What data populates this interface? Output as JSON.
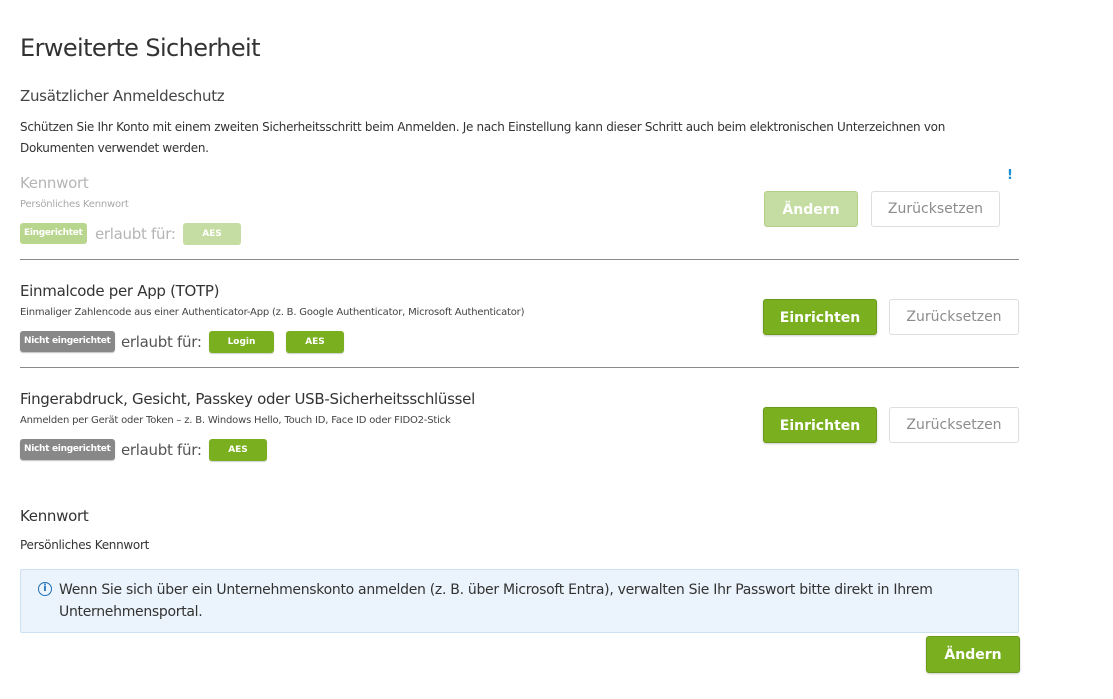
{
  "page": {
    "title": "Erweiterte Sicherheit"
  },
  "login_protection": {
    "title": "Zusätzlicher Anmeldeschutz",
    "description": "Schützen Sie Ihr Konto mit einem zweiten Sicherheitsschritt beim Anmelden. Je nach Einstellung kann dieser Schritt auch beim elektronischen Unterzeichnen von Dokumenten verwendet werden.",
    "allowed_label": "erlaubt für:",
    "methods": [
      {
        "name": "Kennwort",
        "subtitle": "Persönliches Kennwort",
        "status": "Eingerichtet",
        "tags": [
          "AES"
        ],
        "warning_icon": "!",
        "primary_action": "Ändern",
        "secondary_action": "Zurücksetzen",
        "disabled": true
      },
      {
        "name": "Einmalcode per App (TOTP)",
        "subtitle": "Einmaliger Zahlencode aus einer Authenticator-App (z. B. Google Authenticator, Microsoft Authenticator)",
        "status": "Nicht eingerichtet",
        "tags": [
          "Login",
          "AES"
        ],
        "primary_action": "Einrichten",
        "secondary_action": "Zurücksetzen",
        "disabled": false
      },
      {
        "name": "Fingerabdruck, Gesicht, Passkey oder USB-Sicherheitsschlüssel",
        "subtitle": "Anmelden per Gerät oder Token – z. B. Windows Hello, Touch ID, Face ID oder FIDO2-Stick",
        "status": "Nicht eingerichtet",
        "tags": [
          "AES"
        ],
        "primary_action": "Einrichten",
        "secondary_action": "Zurücksetzen",
        "disabled": false
      }
    ]
  },
  "password": {
    "title": "Kennwort",
    "subtitle": "Persönliches Kennwort",
    "info_icon": "i",
    "info_text": "Wenn Sie sich über ein Unternehmenskonto anmelden (z. B. über Microsoft Entra), verwalten Sie Ihr Passwort bitte direkt in Ihrem Unternehmensportal.",
    "change_button": "Ändern"
  },
  "colors": {
    "accent_green": "#7ab01f",
    "info_blue": "#1f6fb5",
    "status_gray": "#888888"
  }
}
